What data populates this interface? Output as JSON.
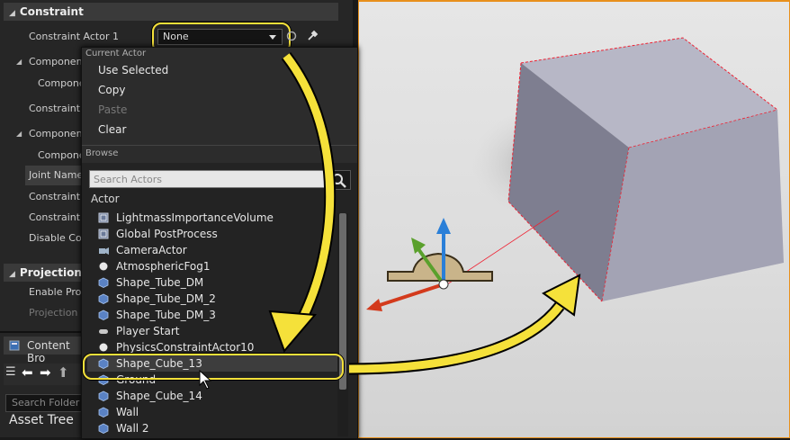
{
  "details": {
    "constraint_header": "Constraint",
    "constraint_actor_1_label": "Constraint Actor 1",
    "combo_value": "None",
    "props": [
      {
        "label": "Component",
        "indent": 1
      },
      {
        "label": "Compone",
        "indent": 2
      },
      {
        "label": "Constraint A",
        "indent": 0
      },
      {
        "label": "Component",
        "indent": 1
      },
      {
        "label": "Compone",
        "indent": 2
      },
      {
        "label": "Joint Name",
        "indent": 0
      },
      {
        "label": "Constraint E",
        "indent": 0
      },
      {
        "label": "Constraint E",
        "indent": 0
      },
      {
        "label": "Disable Coll",
        "indent": 0
      }
    ],
    "projection_header": "Projection",
    "enable_projection_label": "Enable Proje",
    "projection_l_label": "Projection L"
  },
  "content_browser": {
    "tab_label": "Content Bro",
    "search_placeholder": "Search Folder",
    "asset_tree_label": "Asset Tree"
  },
  "menu": {
    "current_actor_header": "Current Actor",
    "items": [
      {
        "label": "Use Selected",
        "enabled": true
      },
      {
        "label": "Copy",
        "enabled": true
      },
      {
        "label": "Paste",
        "enabled": false
      },
      {
        "label": "Clear",
        "enabled": true
      }
    ],
    "browse_header": "Browse",
    "search_placeholder": "Search Actors",
    "actor_column_header": "Actor",
    "actors": [
      {
        "label": "LightmassImportanceVolume",
        "icon": "volume-icon"
      },
      {
        "label": "Global PostProcess",
        "icon": "volume-icon"
      },
      {
        "label": "CameraActor",
        "icon": "camera-icon"
      },
      {
        "label": "AtmosphericFog1",
        "icon": "sphere-icon"
      },
      {
        "label": "Shape_Tube_DM",
        "icon": "mesh-icon"
      },
      {
        "label": "Shape_Tube_DM_2",
        "icon": "mesh-icon"
      },
      {
        "label": "Shape_Tube_DM_3",
        "icon": "mesh-icon"
      },
      {
        "label": "Player Start",
        "icon": "gamepad-icon"
      },
      {
        "label": "PhysicsConstraintActor10",
        "icon": "sphere-icon"
      },
      {
        "label": "Shape_Cube_13",
        "icon": "mesh-icon",
        "selected": true
      },
      {
        "label": "Ground",
        "icon": "mesh-icon"
      },
      {
        "label": "Shape_Cube_14",
        "icon": "mesh-icon"
      },
      {
        "label": "Wall",
        "icon": "mesh-icon"
      },
      {
        "label": "Wall 2",
        "icon": "mesh-icon"
      }
    ]
  },
  "colors": {
    "highlight_yellow": "#f5e13a",
    "viewport_border": "#e8901c",
    "gizmo_x": "#d33a1c",
    "gizmo_y": "#5aa02c",
    "gizmo_z": "#2a7fd8"
  }
}
